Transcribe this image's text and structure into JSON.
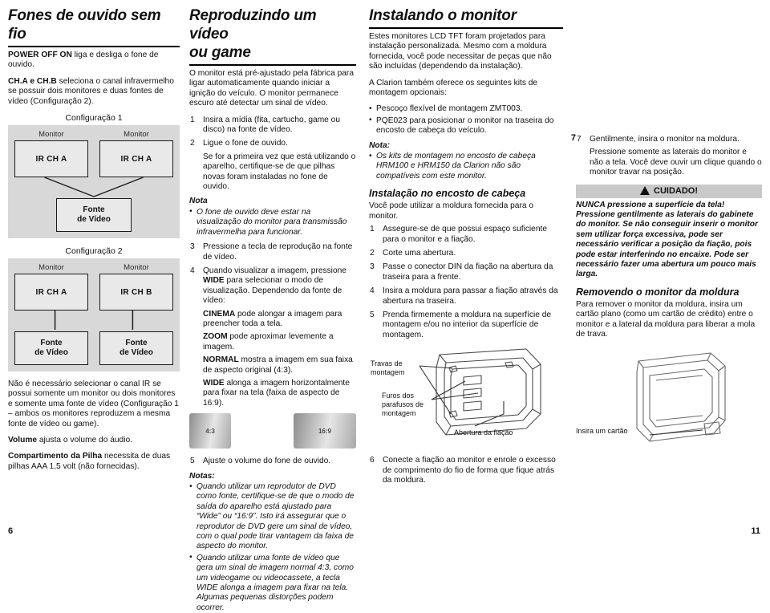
{
  "document": {
    "page_left": "6",
    "page_right": "11",
    "page_mid": "7"
  },
  "col1": {
    "title": "Fones de ouvido sem fio",
    "p_power_bold": "POWER OFF ON",
    "p_power_rest": " liga e desliga o fone de ouvido.",
    "p_ch_bold": "CH.A e CH.B",
    "p_ch_rest": " seleciona o canal infravermelho se possuir dois monitores e duas fontes de vídeo (Configuração 2).",
    "cfg1": {
      "title": "Configuração 1",
      "monitor_label": "Monitor",
      "box_left": "IR CH A",
      "box_right": "IR CH A",
      "source_line1": "Fonte",
      "source_line2": "de Vídeo"
    },
    "cfg2": {
      "title": "Configuração 2",
      "monitor_label": "Monitor",
      "box_left": "IR CH A",
      "box_right": "IR CH B",
      "source_line1": "Fonte",
      "source_line2": "de Vídeo"
    },
    "p_ir": "Não é necessário selecionar o canal IR se possui somente um monitor ou dois monitores e somente uma fonte de vídeo (Configuração 1 – ambos os monitores reproduzem a mesma fonte de vídeo ou game).",
    "p_volume_bold": "Volume",
    "p_volume_rest": " ajusta o volume do áudio.",
    "p_batt_bold": "Compartimento da Pilha",
    "p_batt_rest": " necessita de duas pilhas AAA 1,5 volt (não fornecidas)."
  },
  "col2": {
    "title_line1": "Reproduzindo um vídeo",
    "title_line2": "ou game",
    "intro": "O monitor está pré-ajustado pela fábrica para ligar automaticamente quando iniciar a ignição do veículo. O monitor permanece escuro até detectar um sinal de vídeo.",
    "steps": [
      {
        "num": "1",
        "text": "Insira a mídia (fita, cartucho, game ou disco) na fonte de vídeo."
      },
      {
        "num": "2",
        "text": "Ligue o fone de ouvido."
      }
    ],
    "step2_extra": "Se for a primeira vez que está utilizando o aparelho, certifique-se de que pilhas novas foram instaladas no fone de ouvido.",
    "nota_heading": "Nota",
    "nota_bullet": "O fone de ouvido deve estar na visualização do monitor para transmissão infravermelha para funcionar.",
    "step3_num": "3",
    "step3_text": "Pressione a tecla de reprodução na fonte de vídeo.",
    "step4_num": "4",
    "step4_a": "Quando visualizar a imagem, pressione ",
    "step4_wide": "WIDE",
    "step4_b": " para selecionar o modo de visualização. Dependendo da fonte de vídeo:",
    "cinema_bold": "CINEMA",
    "cinema_rest": " pode alongar a imagem para preencher toda a tela.",
    "zoom_bold": "ZOOM",
    "zoom_rest": " pode aproximar levemente a imagem.",
    "normal_bold": "NORMAL",
    "normal_rest": " mostra a imagem em sua faixa de aspecto original (4:3).",
    "wide_bold": "WIDE",
    "wide_rest": " alonga a imagem horizontalmente para fixar na tela (faixa de aspecto de 16:9).",
    "ratio_43": "4:3",
    "ratio_169": "16:9",
    "step5_num": "5",
    "step5_text": "Ajuste o volume do fone de ouvido.",
    "notas_heading": "Notas:",
    "notas_bullets": [
      "Quando utilizar um reprodutor de DVD como fonte, certifique-se de que o modo de saída do aparelho está ajustado para “Wide” ou “16:9”. Isto irá assegurar que o reprodutor de DVD gere um sinal de vídeo, com o qual pode tirar vantagem da faixa de aspecto do monitor.",
      "Quando utilizar uma fonte de vídeo que gera um sinal de imagem normal 4:3, como um videogame ou videocassete, a tecla WIDE alonga a imagem para fixar na tela. Algumas pequenas distorções podem ocorrer."
    ]
  },
  "col3": {
    "title": "Instalando o monitor",
    "p1": "Estes monitores LCD TFT foram projetados para instalação personalizada. Mesmo com a moldura fornecida, você pode necessitar de peças que não são incluídas (dependendo da instalação).",
    "p2": "A Clarion também oferece os seguintes kits de montagem opcionais:",
    "kits": [
      "Pescoço flexível de montagem ZMT003.",
      "PQE023 para posicionar o monitor na traseira do encosto de cabeça do veículo."
    ],
    "nota_heading": "Nota:",
    "nota_bullet": "Os kits de montagem no encosto de cabeça HRM100 e HRM150 da Clarion não são compatíveis com este monitor.",
    "sub_heading": "Instalação no encosto de cabeça",
    "sub_intro": "Você pode utilizar a moldura fornecida para o monitor.",
    "steps": [
      {
        "num": "1",
        "text": "Assegure-se de que possui espaço suficiente para o monitor e a fiação."
      },
      {
        "num": "2",
        "text": "Corte uma abertura."
      },
      {
        "num": "3",
        "text": "Passe o conector DIN da fiação na abertura da traseira para a frente."
      },
      {
        "num": "4",
        "text": "Insira a moldura para passar a fiação através da abertura na traseira."
      },
      {
        "num": "5",
        "text": "Prenda firmemente a moldura na superfície de montagem e/ou no interior da superfície de montagem."
      }
    ],
    "fig_labels": {
      "locks": "Travas de\nmontagem",
      "screw_holes": "Furos dos\nparafusos de\nmontagem",
      "wire_opening": "Abertura da fiação"
    },
    "step6_num": "6",
    "step6_text": "Conecte a fiação ao monitor e enrole o excesso de comprimento do fio de forma que fique atrás da moldura."
  },
  "col4": {
    "step7_num": "7",
    "step7_text": "Gentilmente, insira o monitor na moldura.",
    "step7_extra": "Pressione somente as laterais do monitor e não a tela. Você deve ouvir um clique quando o monitor travar na posição.",
    "caution_label": "CUIDADO!",
    "caution_text": "NUNCA pressione a superfície da tela! Pressione gentilmente as laterais do gabinete do monitor. Se não conseguir inserir o monitor sem utilizar força excessiva, pode ser necessário verificar a posição da fiação, pois pode estar interferindo no encaixe. Pode ser necessário fazer uma abertura um pouco mais larga.",
    "sub_heading": "Removendo o monitor da moldura",
    "sub_text": "Para remover o monitor da moldura, insira um cartão plano (como um cartão de crédito) entre o monitor e a lateral da moldura para liberar a mola de trava.",
    "fig_label_card": "Insira um cartão"
  }
}
